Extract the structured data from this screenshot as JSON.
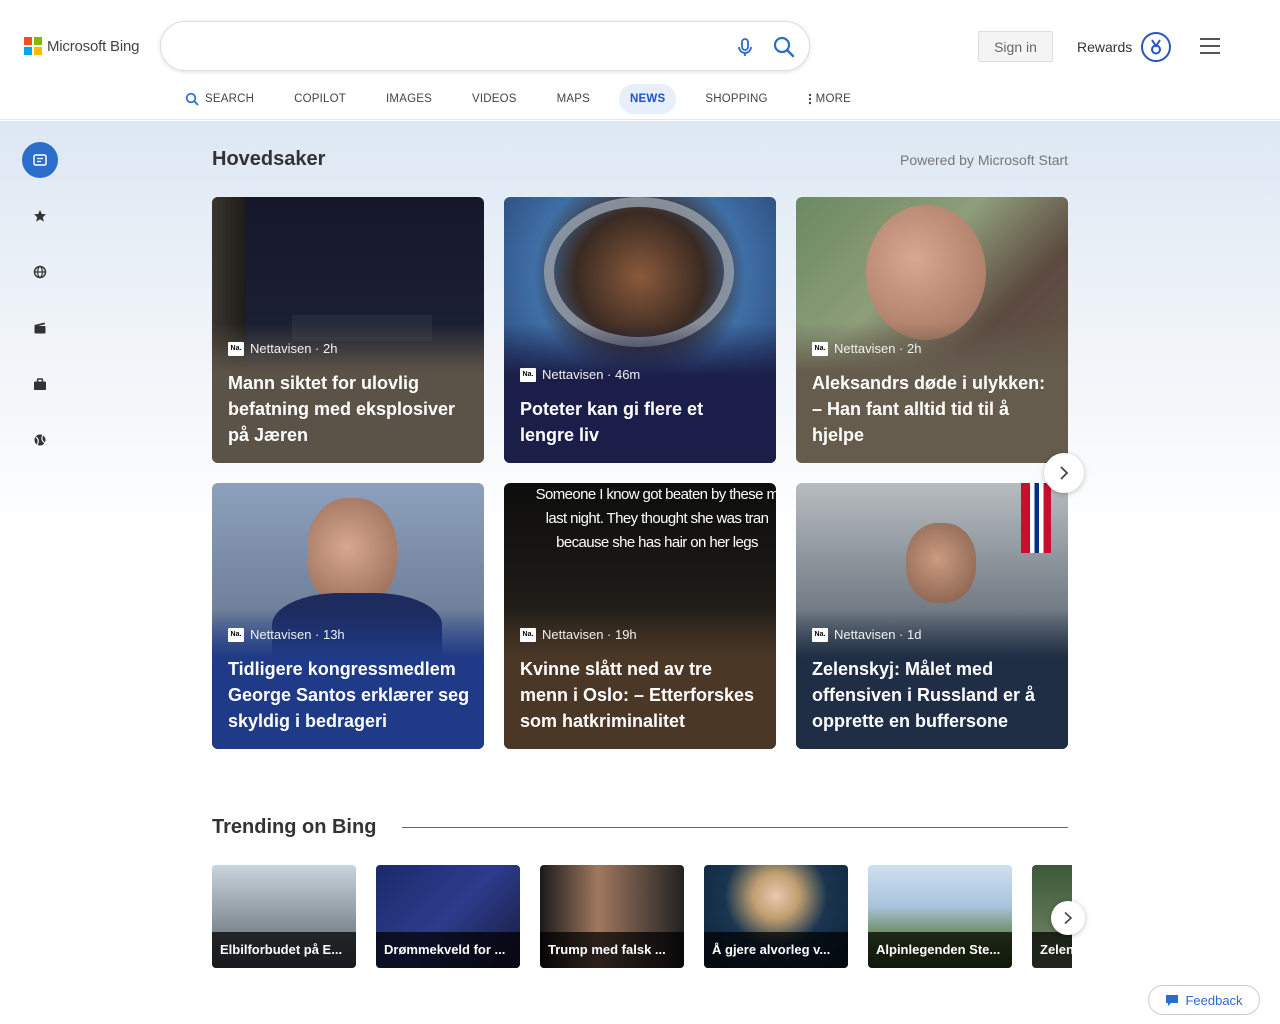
{
  "brand": {
    "name": "Microsoft Bing",
    "colors": [
      "#f25022",
      "#7fba00",
      "#00a4ef",
      "#ffb900"
    ]
  },
  "search": {
    "value": "",
    "placeholder": ""
  },
  "header": {
    "signin_label": "Sign in",
    "rewards_label": "Rewards"
  },
  "nav": {
    "items": [
      {
        "label": "SEARCH",
        "icon": "search-icon"
      },
      {
        "label": "COPILOT"
      },
      {
        "label": "IMAGES"
      },
      {
        "label": "VIDEOS"
      },
      {
        "label": "MAPS"
      },
      {
        "label": "NEWS",
        "active": true
      },
      {
        "label": "SHOPPING"
      },
      {
        "label": "MORE",
        "icon": "more-dots-icon"
      }
    ]
  },
  "sidebar": {
    "items": [
      "news-icon",
      "star-icon",
      "globe-icon",
      "entertainment-icon",
      "briefcase-icon",
      "sports-icon"
    ],
    "active": 0
  },
  "main": {
    "title": "Hovedsaker",
    "powered_by": "Powered by Microsoft Start",
    "cards": [
      {
        "source": "Nettavisen · 2h",
        "headline": "Mann siktet for ulovlig befatning med eksplosiver på Jæren"
      },
      {
        "source": "Nettavisen · 46m",
        "headline": "Poteter kan gi flere et lengre liv"
      },
      {
        "source": "Nettavisen · 2h",
        "headline": "Aleksandrs døde i ulykken: – Han fant alltid tid til å hjelpe"
      },
      {
        "source": "Nettavisen · 13h",
        "headline": "Tidligere kongressmedlem George Santos erklærer seg skyldig i bedrageri"
      },
      {
        "source": "Nettavisen · 19h",
        "headline": "Kvinne slått ned av tre menn i Oslo: – Etterforskes som hatkriminalitet",
        "image_text": "Someone I know got beaten by these m last night. They thought she was tran because she has hair on her legs"
      },
      {
        "source": "Nettavisen · 1d",
        "headline": "Zelenskyj: Målet med offensiven i Russland er å opprette en buffersone"
      }
    ]
  },
  "trending": {
    "title": "Trending on Bing",
    "items": [
      {
        "label": "Elbilforbudet på E..."
      },
      {
        "label": "Drømmekveld for ..."
      },
      {
        "label": "Trump med falsk ..."
      },
      {
        "label": "Å gjere alvorleg v..."
      },
      {
        "label": "Alpinlegenden Ste..."
      },
      {
        "label": "Zelen"
      }
    ]
  },
  "feedback_label": "Feedback"
}
